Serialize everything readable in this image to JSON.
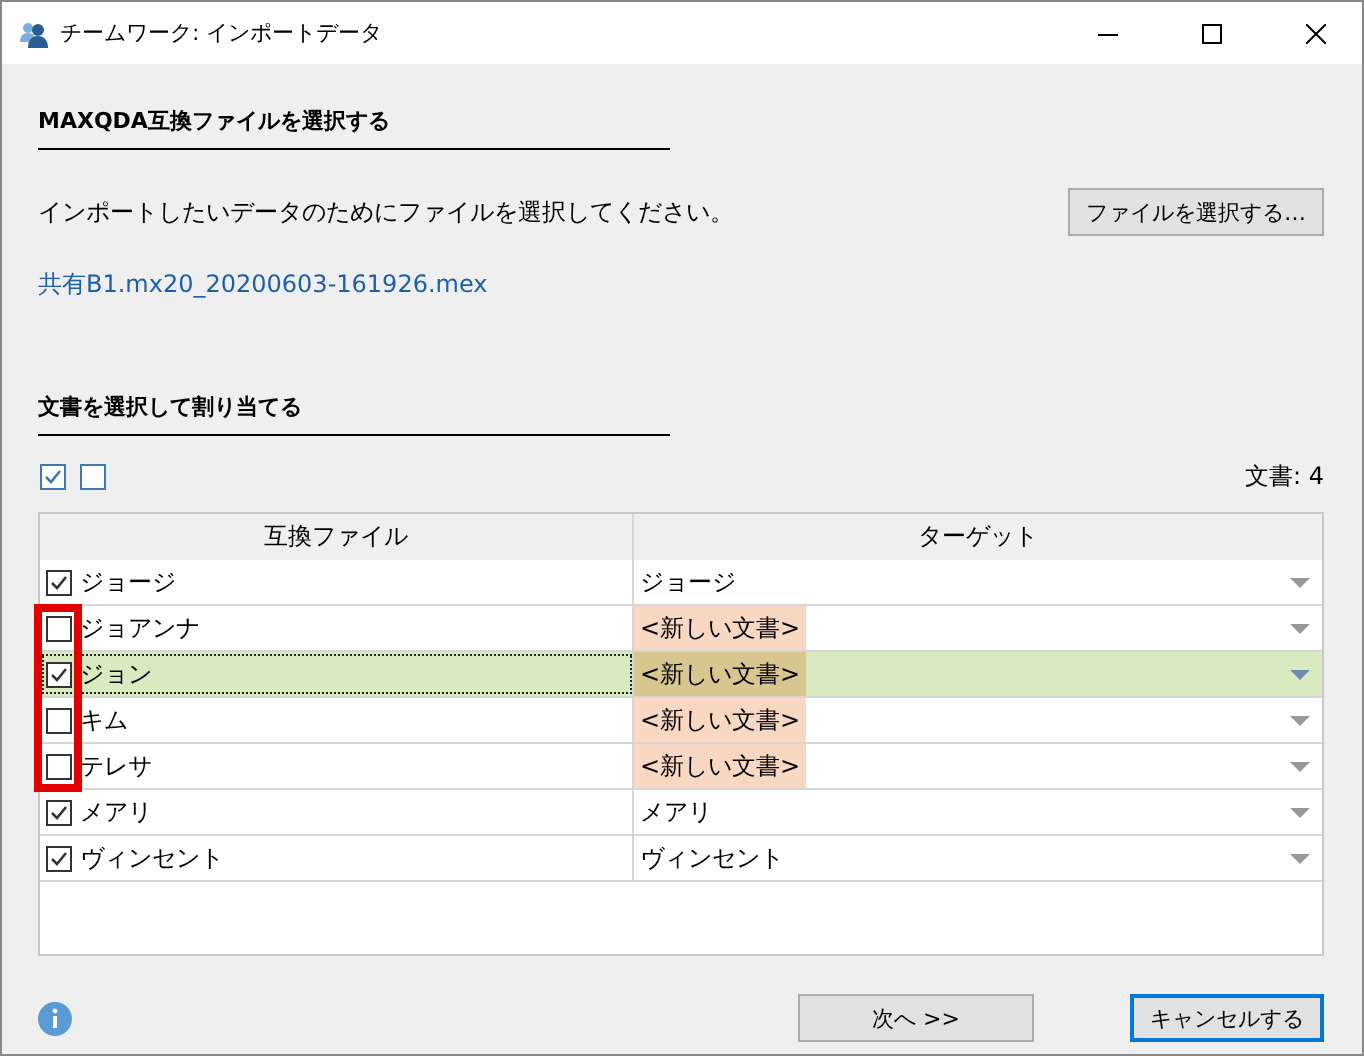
{
  "window": {
    "title": "チームワーク: インポートデータ"
  },
  "file_section": {
    "heading": "MAXQDA互換ファイルを選択する",
    "instruction": "インポートしたいデータのためにファイルを選択してください。",
    "choose_button": "ファイルを選択する…",
    "file_link": "共有B1.mx20_20200603-161926.mex"
  },
  "assign_section": {
    "heading": "文書を選択して割り当てる",
    "document_count": "文書: 4"
  },
  "table": {
    "columns": [
      "互換ファイル",
      "ターゲット"
    ],
    "rows": [
      {
        "name": "ジョージ",
        "checked": true,
        "target": "ジョージ",
        "new_document": false,
        "selected": false,
        "marked": false
      },
      {
        "name": "ジョアンナ",
        "checked": false,
        "target": "<新しい文書>",
        "new_document": true,
        "selected": false,
        "marked": true
      },
      {
        "name": "ジョン",
        "checked": true,
        "target": "<新しい文書>",
        "new_document": true,
        "selected": true,
        "marked": true
      },
      {
        "name": "キム",
        "checked": false,
        "target": "<新しい文書>",
        "new_document": true,
        "selected": false,
        "marked": true
      },
      {
        "name": "テレサ",
        "checked": false,
        "target": "<新しい文書>",
        "new_document": true,
        "selected": false,
        "marked": true
      },
      {
        "name": "メアリ",
        "checked": true,
        "target": "メアリ",
        "new_document": false,
        "selected": false,
        "marked": false
      },
      {
        "name": "ヴィンセント",
        "checked": true,
        "target": "ヴィンセント",
        "new_document": false,
        "selected": false,
        "marked": false
      }
    ]
  },
  "buttons": [
    {
      "label": "次へ >>",
      "default": false
    },
    {
      "label": "キャンセルする",
      "default": true
    }
  ]
}
